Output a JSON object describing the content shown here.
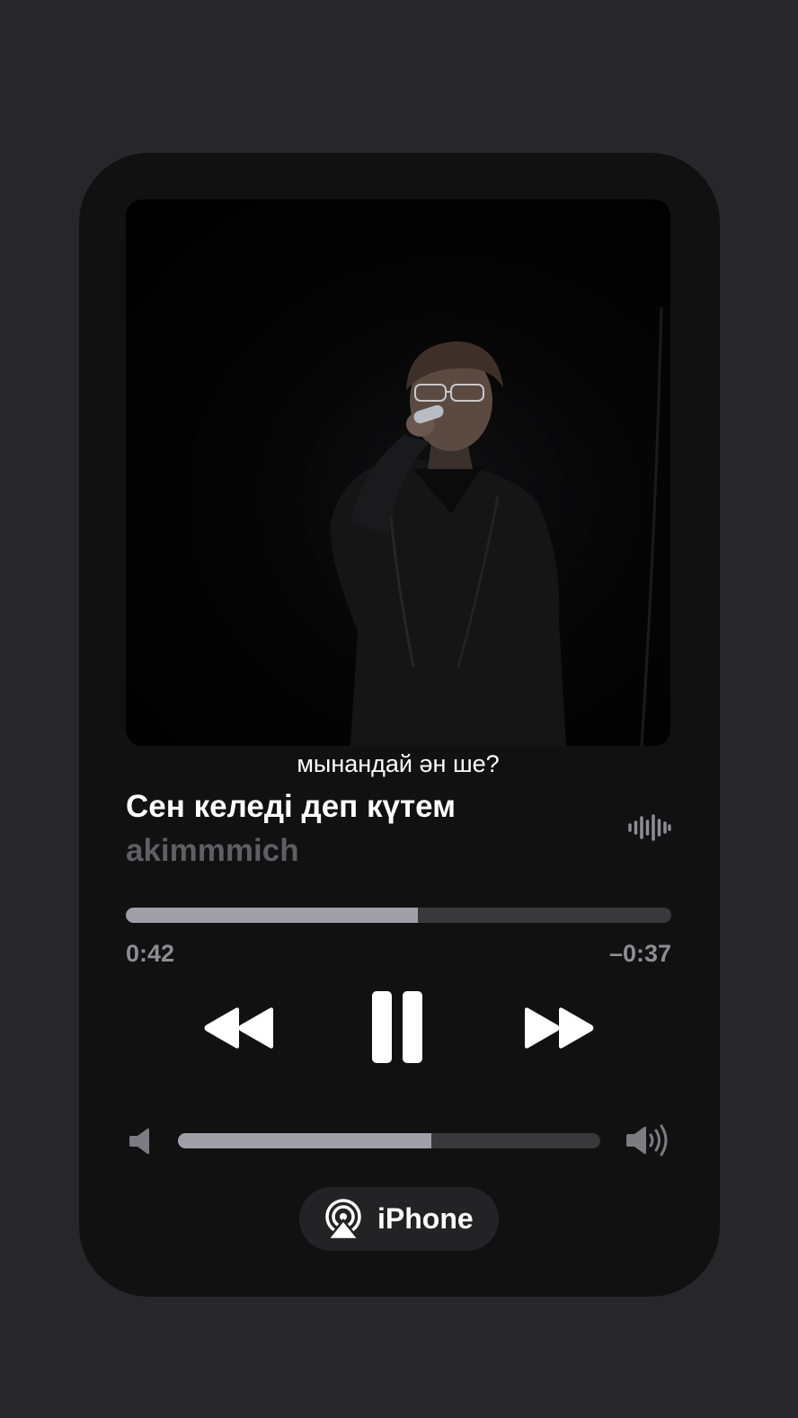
{
  "player": {
    "caption": "мынандай ән ше?",
    "title": "Сен келеді деп күтем",
    "artist": "akimmmich",
    "progress": {
      "elapsed": "0:42",
      "remaining": "–0:37",
      "fraction": 0.536
    },
    "volume": {
      "fraction": 0.6
    },
    "route": {
      "label": "iPhone"
    },
    "colors": {
      "background": "#27262b",
      "card": "#111112",
      "track": "#39393c",
      "fill": "#a09ea6",
      "secondary_text": "#5e5e64"
    },
    "icons": {
      "waveform": "waveform-icon",
      "rewind": "rewind-icon",
      "pause": "pause-icon",
      "forward": "fast-forward-icon",
      "volume_low": "speaker-low-icon",
      "volume_high": "speaker-high-icon",
      "airplay": "airplay-icon"
    }
  }
}
